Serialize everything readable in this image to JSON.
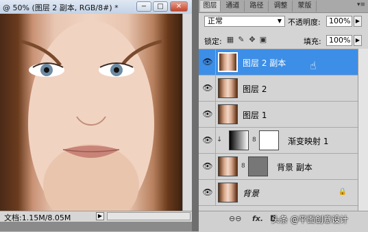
{
  "document": {
    "title": "@ 50% (图层 2 副本, RGB/8#) *",
    "status_text": "文档:1.15M/8.05M",
    "window_buttons": {
      "minimize": "−",
      "maximize": "□",
      "close": "✕"
    }
  },
  "panel": {
    "tabs": [
      "图层",
      "通道",
      "路径",
      "调整",
      "蒙版"
    ],
    "menu_glyph": "▾≡",
    "blend_mode": "正常",
    "opacity_label": "不透明度:",
    "opacity_value": "100%",
    "lock_label": "锁定:",
    "fill_label": "填充:",
    "fill_value": "100%",
    "layers": [
      {
        "name": "图层 2 副本",
        "selected": true
      },
      {
        "name": "图层 2",
        "selected": false
      },
      {
        "name": "图层 1",
        "selected": false
      },
      {
        "name": "渐变映射 1",
        "selected": false
      },
      {
        "name": "背景 副本",
        "selected": false
      },
      {
        "name": "背景",
        "selected": false
      }
    ],
    "bottom_icons": [
      "link-icon",
      "fx-icon"
    ],
    "fx_label": "fx."
  },
  "watermark": "头条 @平面创意设计",
  "icons": {
    "eye": "👁",
    "chain": "8",
    "lock": "🔒",
    "hand_cursor": "☝",
    "link": "⊖⊖",
    "clip_arrow": "↓"
  }
}
